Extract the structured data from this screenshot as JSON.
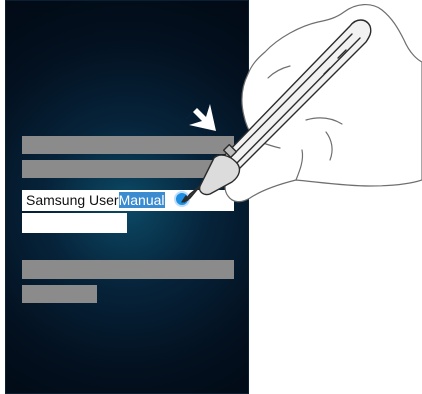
{
  "text_field": {
    "value_plain": "Samsung User",
    "value_selected": "Manual"
  },
  "icons": {
    "arrow": "drag-arrow-icon",
    "pen": "s-pen-icon",
    "hand": "hand-icon"
  },
  "colors": {
    "screen_bg": "#041424",
    "bar_gray": "#8b8b8b",
    "selection": "#3a8bd0",
    "cursor": "#1e8fe0"
  }
}
